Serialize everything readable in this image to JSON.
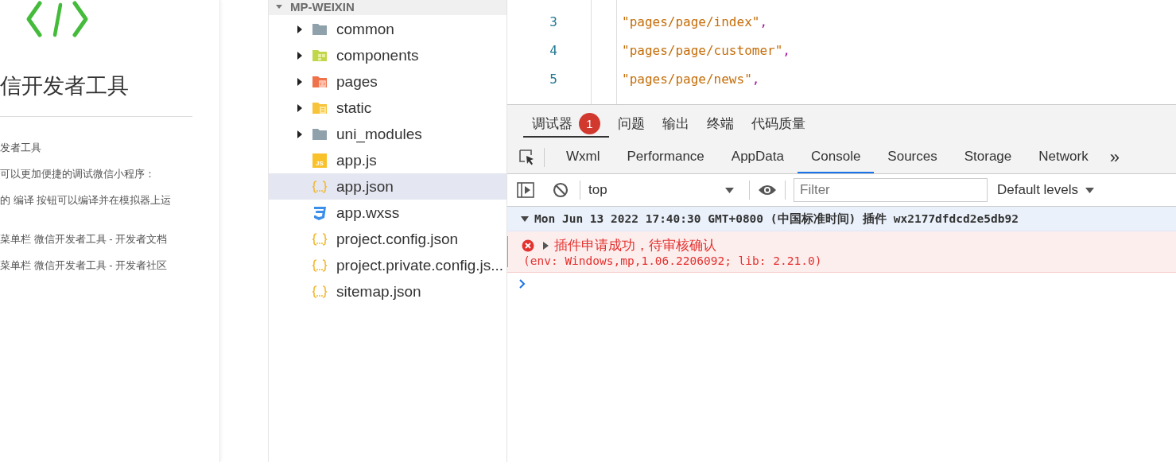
{
  "simulator": {
    "title": "信开发者工具",
    "lines": [
      "发者工具",
      "可以更加便捷的调试微信小程序：",
      "的 编译 按钮可以编译并在模拟器上运",
      "菜单栏 微信开发者工具 - 开发者文档",
      "菜单栏 微信开发者工具 - 开发者社区"
    ]
  },
  "explorer": {
    "root": {
      "label": "MP-WEIXIN",
      "expanded": true
    },
    "items": [
      {
        "name": "common",
        "kind": "folder",
        "expanded": false,
        "selected": false
      },
      {
        "name": "components",
        "kind": "components-folder",
        "expanded": false,
        "selected": false
      },
      {
        "name": "pages",
        "kind": "pages-folder",
        "expanded": false,
        "selected": false
      },
      {
        "name": "static",
        "kind": "static-folder",
        "expanded": false,
        "selected": false
      },
      {
        "name": "uni_modules",
        "kind": "folder",
        "expanded": false,
        "selected": false
      },
      {
        "name": "app.js",
        "kind": "js",
        "icon_text": "JS",
        "selected": false
      },
      {
        "name": "app.json",
        "kind": "json",
        "selected": true
      },
      {
        "name": "app.wxss",
        "kind": "css",
        "selected": false
      },
      {
        "name": "project.config.json",
        "kind": "json",
        "selected": false
      },
      {
        "name": "project.private.config.js...",
        "kind": "json",
        "selected": false
      },
      {
        "name": "sitemap.json",
        "kind": "json",
        "selected": false
      }
    ]
  },
  "editor": {
    "lines": [
      {
        "number": "3",
        "string": "\"pages/page/index\"",
        "punct": ","
      },
      {
        "number": "4",
        "string": "\"pages/page/customer\"",
        "punct": ","
      },
      {
        "number": "5",
        "string": "\"pages/page/news\"",
        "punct": ","
      }
    ]
  },
  "devtools": {
    "panel_tabs": [
      {
        "label": "调试器",
        "selected": true,
        "badge": "1"
      },
      {
        "label": "问题",
        "selected": false
      },
      {
        "label": "输出",
        "selected": false
      },
      {
        "label": "终端",
        "selected": false
      },
      {
        "label": "代码质量",
        "selected": false
      }
    ],
    "tool_tabs": [
      {
        "label": "Wxml",
        "selected": false
      },
      {
        "label": "Performance",
        "selected": false
      },
      {
        "label": "AppData",
        "selected": false
      },
      {
        "label": "Console",
        "selected": true
      },
      {
        "label": "Sources",
        "selected": false
      },
      {
        "label": "Storage",
        "selected": false
      },
      {
        "label": "Network",
        "selected": false
      }
    ],
    "more": "»",
    "context": "top",
    "filter": {
      "placeholder": "Filter"
    },
    "levels": "Default levels",
    "log": {
      "group": {
        "text": "Mon Jun 13 2022 17:40:30 GMT+0800 (中国标准时间) 插件 wx2177dfdcd2e5db92",
        "expanded": true
      },
      "error": {
        "message": "插件申请成功，待审核确认",
        "detail": "(env: Windows,mp,1.06.2206092; lib: 2.21.0)",
        "expanded": false
      }
    }
  }
}
